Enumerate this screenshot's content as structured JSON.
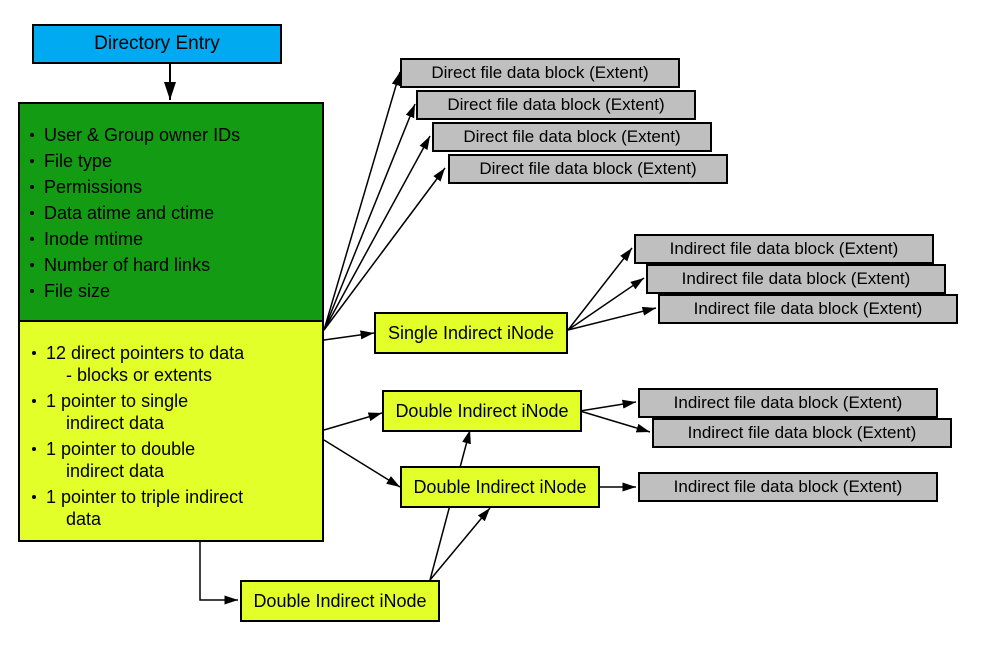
{
  "directory_entry": "Directory Entry",
  "meta_items": [
    "User & Group owner IDs",
    "File type",
    "Permissions",
    "Data atime and ctime",
    "Inode mtime",
    "Number of hard links",
    "File size"
  ],
  "pointer_items": [
    {
      "text": "12 direct pointers to data",
      "sub": "- blocks or extents"
    },
    {
      "text": "1 pointer to single",
      "sub": "indirect data"
    },
    {
      "text": "1 pointer to double",
      "sub": "indirect data"
    },
    {
      "text": "1 pointer to triple indirect",
      "sub": "data"
    }
  ],
  "direct_extents": [
    "Direct file data block (Extent)",
    "Direct file data block (Extent)",
    "Direct file data block (Extent)",
    "Direct file data block (Extent)"
  ],
  "single_indirect": "Single Indirect iNode",
  "single_indirect_extents": [
    "Indirect file data block (Extent)",
    "Indirect file data block (Extent)",
    "Indirect file data block (Extent)"
  ],
  "double_indirect_a": "Double Indirect iNode",
  "double_indirect_a_extents": [
    "Indirect file data block (Extent)",
    "Indirect file data block (Extent)"
  ],
  "double_indirect_b": "Double Indirect iNode",
  "double_indirect_b_extent": "Indirect file data block (Extent)",
  "double_indirect_bottom": "Double Indirect iNode",
  "colors": {
    "dir": "#00aaf0",
    "meta": "#139b13",
    "ptrs": "#e2ff29",
    "extent": "#bfbfbf"
  }
}
